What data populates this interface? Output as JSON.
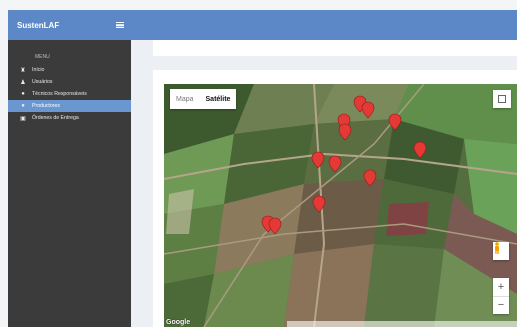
{
  "brand": {
    "title": "SustenLAF",
    "menu_icon": "hamburger-icon"
  },
  "sidebar": {
    "menu_label": "MENU",
    "items": [
      {
        "label": "Início",
        "icon": "home-icon"
      },
      {
        "label": "Usuários",
        "icon": "users-icon"
      },
      {
        "label": "Técnicos Responsáveis",
        "icon": "user-icon"
      },
      {
        "label": "Productores",
        "icon": "person-icon",
        "active": true
      },
      {
        "label": "Órdenes de Entrega",
        "icon": "cart-icon"
      }
    ]
  },
  "map": {
    "type_options": [
      "Mapa",
      "Satélite"
    ],
    "selected_type": "Satélite",
    "zoom_in": "+",
    "zoom_out": "−",
    "provider": "Google"
  },
  "colors": {
    "accent": "#5d88c7",
    "active": "#6b97d1",
    "sidebar_bg": "#3b3b3b",
    "marker": "#e53935"
  }
}
